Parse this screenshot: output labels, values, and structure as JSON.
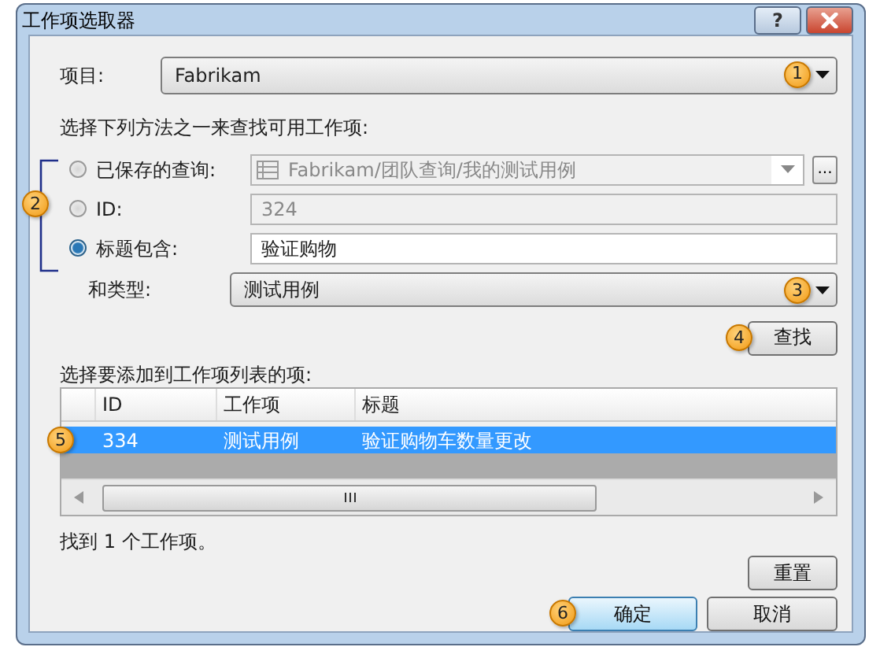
{
  "window": {
    "title": "工作项选取器",
    "buttons": [
      {
        "kind": "help",
        "label": "?"
      },
      {
        "kind": "close"
      }
    ]
  },
  "project": {
    "label": "项目:",
    "value": "Fabrikam",
    "callout": "1"
  },
  "instruction": "选择下列方法之一来查找可用工作项:",
  "methods_callout": "2",
  "methods": [
    {
      "kind": "query",
      "label": "已保存的查询:",
      "value": "Fabrikam/团队查询/我的测试用例",
      "selected": false,
      "disabled": true,
      "browse_label": "..."
    },
    {
      "kind": "text",
      "label": "ID:",
      "value": "324",
      "selected": false,
      "disabled": true
    },
    {
      "kind": "text",
      "label": "标题包含:",
      "value": "验证购物",
      "selected": true,
      "disabled": false
    }
  ],
  "type": {
    "label": "和类型:",
    "value": "测试用例",
    "callout": "3"
  },
  "find_button": {
    "label": "查找",
    "callout": "4"
  },
  "list_label": "选择要添加到工作项列表的项:",
  "table": {
    "columns": [
      "",
      "ID",
      "工作项",
      "标题"
    ],
    "rows": [
      {
        "cells": [
          "",
          "334",
          "测试用例",
          "验证购物车数量更改"
        ],
        "selected": true,
        "callout": "5"
      }
    ]
  },
  "status": "找到 1 个工作项。",
  "reset_button": "重置",
  "ok_button": {
    "label": "确定",
    "callout": "6"
  },
  "cancel_button": "取消"
}
